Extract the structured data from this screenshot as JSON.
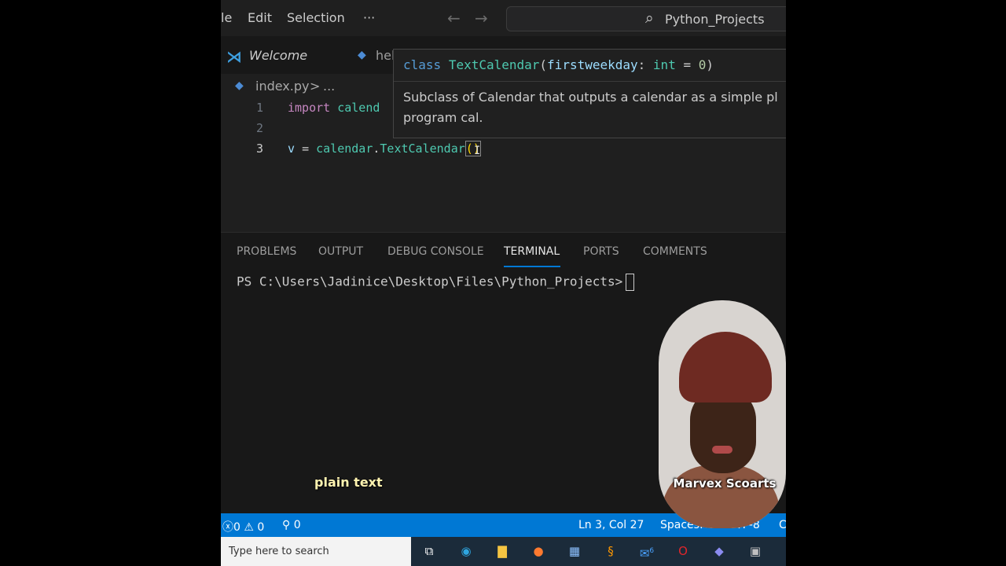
{
  "titlebar": {
    "menu": [
      "le",
      "Edit",
      "Selection",
      "···"
    ],
    "search_label": "Python_Projects"
  },
  "tabs": [
    {
      "label": "Welcome",
      "icon": "vscode-icon"
    },
    {
      "label": "hel",
      "icon": "python-file-icon"
    }
  ],
  "breadcrumb": {
    "file": "index.py",
    "separator": ">",
    "more": "..."
  },
  "editor": {
    "line_numbers": [
      "1",
      "2",
      "3"
    ],
    "line1_kw": "import",
    "line1_mod": "calend",
    "line3_var": "v",
    "line3_eq": "=",
    "line3_obj": "calendar",
    "line3_dot": ".",
    "line3_cls": "TextCalendar",
    "line3_parens": "()"
  },
  "hover": {
    "sig_kw": "class",
    "sig_cls": "TextCalendar",
    "sig_open": "(",
    "sig_param": "firstweekday",
    "sig_colon": ":",
    "sig_type": "int",
    "sig_eq": "=",
    "sig_default": "0",
    "sig_close": ")",
    "doc_line1": "Subclass of Calendar that outputs a calendar as a simple pl",
    "doc_line2": "program cal."
  },
  "panel": {
    "tabs": [
      "PROBLEMS",
      "OUTPUT",
      "DEBUG CONSOLE",
      "TERMINAL",
      "PORTS",
      "COMMENTS"
    ],
    "active_tab": "TERMINAL",
    "terminal_prompt": "PS C:\\Users\\Jadinice\\Desktop\\Files\\Python_Projects>"
  },
  "statusbar": {
    "errors": "0",
    "warnings": "0",
    "ports": "0",
    "position": "Ln 3, Col 27",
    "spaces": "Spaces: 4",
    "encoding": "UTF-8",
    "trailing": "C"
  },
  "taskbar": {
    "search_placeholder": "Type here to search",
    "mail_badge": "6"
  },
  "overlay": {
    "caption": "plain text",
    "presenter_name": "Marvex Scoarts"
  },
  "colors": {
    "accent": "#0078d4",
    "editor_bg": "#1f1f1f",
    "panel_bg": "#181818"
  }
}
